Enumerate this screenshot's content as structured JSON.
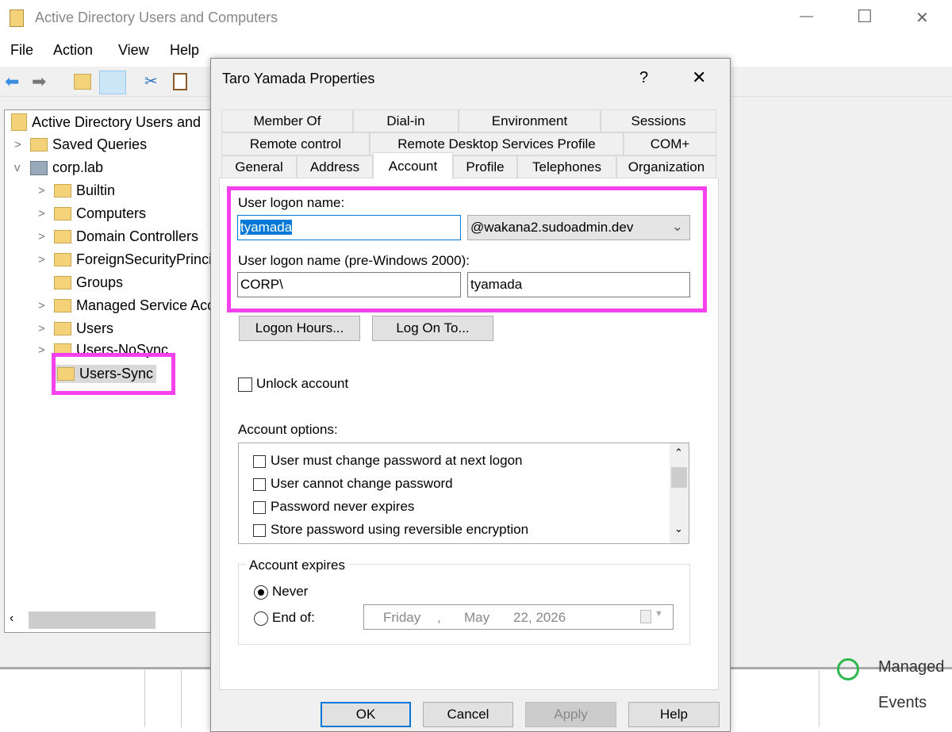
{
  "window": {
    "title": "Active Directory Users and Computers",
    "controls": {
      "minimize": "—",
      "maximize": "☐",
      "close": "✕"
    }
  },
  "menu": [
    "File",
    "Action",
    "View",
    "Help"
  ],
  "tree": {
    "root": "Active Directory Users and",
    "items": [
      {
        "label": "Saved Queries"
      },
      {
        "label": "corp.lab"
      },
      {
        "label": "Builtin"
      },
      {
        "label": "Computers"
      },
      {
        "label": "Domain Controllers"
      },
      {
        "label": "ForeignSecurityPrincipals"
      },
      {
        "label": "Groups"
      },
      {
        "label": "Managed Service Accounts"
      },
      {
        "label": "Users"
      },
      {
        "label": "Users-NoSync"
      },
      {
        "label": "Users-Sync"
      }
    ]
  },
  "background": {
    "right_item1": "Managed",
    "right_item2": "Events"
  },
  "dialog": {
    "title": "Taro Yamada Properties",
    "help": "?",
    "close": "✕",
    "tabs_row1": [
      "Member Of",
      "Dial-in",
      "Environment",
      "Sessions"
    ],
    "tabs_row2": [
      "Remote control",
      "Remote Desktop Services Profile",
      "COM+"
    ],
    "tabs_row3": [
      "General",
      "Address",
      "Account",
      "Profile",
      "Telephones",
      "Organization"
    ],
    "selected_tab": "Account",
    "logon_name_label": "User logon name:",
    "logon_name": "tyamada",
    "domain_suffix": "@wakana2.sudoadmin.dev",
    "pre2000_label": "User logon name (pre-Windows 2000):",
    "pre2000_domain": "CORP\\",
    "pre2000_name": "tyamada",
    "logon_hours": "Logon Hours...",
    "log_on_to": "Log On To...",
    "unlock": "Unlock account",
    "account_options_label": "Account options:",
    "account_options": [
      "User must change password at next logon",
      "User cannot change password",
      "Password never expires",
      "Store password using reversible encryption"
    ],
    "expires_label": "Account expires",
    "never": "Never",
    "end_of": "End of:",
    "date": {
      "weekday": "Friday",
      "sep": ",",
      "month": "May",
      "day_year": "22, 2026"
    },
    "buttons": {
      "ok": "OK",
      "cancel": "Cancel",
      "apply": "Apply",
      "help": "Help"
    }
  }
}
